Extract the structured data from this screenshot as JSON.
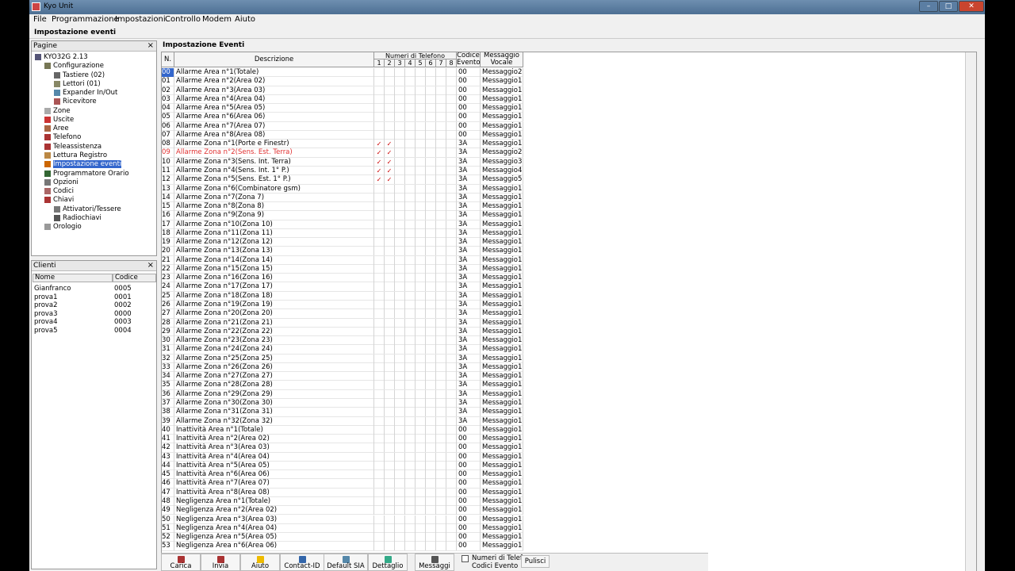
{
  "window": {
    "title": "Kyo Unit",
    "min": "–",
    "max": "□",
    "close": "✕"
  },
  "menu": [
    "File",
    "Programmazione",
    "Impostazioni",
    "Controllo",
    "Modem",
    "Aiuto"
  ],
  "header": "Impostazione eventi",
  "pagine": {
    "title": "Pagine",
    "close": "×",
    "items": [
      {
        "label": "KYO32G 2.13",
        "level": 0,
        "icon": "computer-icon"
      },
      {
        "label": "Configurazione",
        "level": 1,
        "icon": "wrench-icon"
      },
      {
        "label": "Tastiere (02)",
        "level": 2,
        "icon": "keypad-icon"
      },
      {
        "label": "Lettori (01)",
        "level": 2,
        "icon": "reader-icon"
      },
      {
        "label": "Expander In/Out",
        "level": 2,
        "icon": "expander-icon"
      },
      {
        "label": "Ricevitore",
        "level": 2,
        "icon": "antenna-icon"
      },
      {
        "label": "Zone",
        "level": 1,
        "icon": "zone-icon"
      },
      {
        "label": "Uscite",
        "level": 1,
        "icon": "output-icon"
      },
      {
        "label": "Aree",
        "level": 1,
        "icon": "area-icon"
      },
      {
        "label": "Telefono",
        "level": 1,
        "icon": "phone-icon"
      },
      {
        "label": "Teleassistenza",
        "level": 1,
        "icon": "remote-icon"
      },
      {
        "label": "Lettura Registro",
        "level": 1,
        "icon": "log-icon"
      },
      {
        "label": "Impostazione eventi",
        "level": 1,
        "icon": "event-icon",
        "selected": true
      },
      {
        "label": "Programmatore Orario",
        "level": 1,
        "icon": "scheduler-icon"
      },
      {
        "label": "Opzioni",
        "level": 1,
        "icon": "options-icon"
      },
      {
        "label": "Codici",
        "level": 1,
        "icon": "codes-icon"
      },
      {
        "label": "Chiavi",
        "level": 1,
        "icon": "key-icon"
      },
      {
        "label": "Attivatori/Tessere",
        "level": 2,
        "icon": "activator-icon"
      },
      {
        "label": "Radiochiavi",
        "level": 2,
        "icon": "radiokey-icon"
      },
      {
        "label": "Orologio",
        "level": 1,
        "icon": "clock-icon"
      }
    ]
  },
  "clienti": {
    "title": "Clienti",
    "close": "×",
    "col_nome": "Nome",
    "col_codice": "Codice",
    "rows": [
      [
        "Gianfranco",
        "0005"
      ],
      [
        "prova1",
        "0001"
      ],
      [
        "prova2",
        "0002"
      ],
      [
        "prova3",
        "0000"
      ],
      [
        "prova4",
        "0003"
      ],
      [
        "prova5",
        "0004"
      ]
    ]
  },
  "main": {
    "title": "Impostazione Eventi",
    "headers": {
      "n": "N.",
      "descrizione": "Descrizione",
      "numeri": "Numeri di Telefono",
      "phones": [
        "1",
        "2",
        "3",
        "4",
        "5",
        "6",
        "7",
        "8"
      ],
      "codice": "Codice Evento",
      "messaggio": "Messaggio Vocale"
    },
    "rows": [
      [
        "00",
        "Allarme Area n°1(Totale)",
        "",
        "",
        "00",
        "Messaggio2"
      ],
      [
        "01",
        "Allarme Area n°2(Area 02)",
        "",
        "",
        "00",
        "Messaggio1"
      ],
      [
        "02",
        "Allarme Area n°3(Area 03)",
        "",
        "",
        "00",
        "Messaggio1"
      ],
      [
        "03",
        "Allarme Area n°4(Area 04)",
        "",
        "",
        "00",
        "Messaggio1"
      ],
      [
        "04",
        "Allarme Area n°5(Area 05)",
        "",
        "",
        "00",
        "Messaggio1"
      ],
      [
        "05",
        "Allarme Area n°6(Area 06)",
        "",
        "",
        "00",
        "Messaggio1"
      ],
      [
        "06",
        "Allarme Area n°7(Area 07)",
        "",
        "",
        "00",
        "Messaggio1"
      ],
      [
        "07",
        "Allarme Area n°8(Area 08)",
        "",
        "",
        "00",
        "Messaggio1"
      ],
      [
        "08",
        "Allarme Zona n°1(Porte e  Finestr)",
        "✓",
        "✓",
        "3A",
        "Messaggio1"
      ],
      [
        "09",
        "Allarme Zona n°2(Sens. Est. Terra)",
        "✓",
        "✓",
        "3A",
        "Messaggio2"
      ],
      [
        "10",
        "Allarme Zona n°3(Sens. Int. Terra)",
        "✓",
        "✓",
        "3A",
        "Messaggio3"
      ],
      [
        "11",
        "Allarme Zona n°4(Sens. Int. 1° P.)",
        "✓",
        "✓",
        "3A",
        "Messaggio4"
      ],
      [
        "12",
        "Allarme Zona n°5(Sens. Est. 1° P.)",
        "✓",
        "✓",
        "3A",
        "Messaggio5"
      ],
      [
        "13",
        "Allarme Zona n°6(Combinatore gsm)",
        "",
        "",
        "3A",
        "Messaggio1"
      ],
      [
        "14",
        "Allarme Zona n°7(Zona 7)",
        "",
        "",
        "3A",
        "Messaggio1"
      ],
      [
        "15",
        "Allarme Zona n°8(Zona 8)",
        "",
        "",
        "3A",
        "Messaggio1"
      ],
      [
        "16",
        "Allarme Zona n°9(Zona 9)",
        "",
        "",
        "3A",
        "Messaggio1"
      ],
      [
        "17",
        "Allarme Zona n°10(Zona 10)",
        "",
        "",
        "3A",
        "Messaggio1"
      ],
      [
        "18",
        "Allarme Zona n°11(Zona 11)",
        "",
        "",
        "3A",
        "Messaggio1"
      ],
      [
        "19",
        "Allarme Zona n°12(Zona 12)",
        "",
        "",
        "3A",
        "Messaggio1"
      ],
      [
        "20",
        "Allarme Zona n°13(Zona 13)",
        "",
        "",
        "3A",
        "Messaggio1"
      ],
      [
        "21",
        "Allarme Zona n°14(Zona 14)",
        "",
        "",
        "3A",
        "Messaggio1"
      ],
      [
        "22",
        "Allarme Zona n°15(Zona 15)",
        "",
        "",
        "3A",
        "Messaggio1"
      ],
      [
        "23",
        "Allarme Zona n°16(Zona 16)",
        "",
        "",
        "3A",
        "Messaggio1"
      ],
      [
        "24",
        "Allarme Zona n°17(Zona 17)",
        "",
        "",
        "3A",
        "Messaggio1"
      ],
      [
        "25",
        "Allarme Zona n°18(Zona 18)",
        "",
        "",
        "3A",
        "Messaggio1"
      ],
      [
        "26",
        "Allarme Zona n°19(Zona 19)",
        "",
        "",
        "3A",
        "Messaggio1"
      ],
      [
        "27",
        "Allarme Zona n°20(Zona 20)",
        "",
        "",
        "3A",
        "Messaggio1"
      ],
      [
        "28",
        "Allarme Zona n°21(Zona 21)",
        "",
        "",
        "3A",
        "Messaggio1"
      ],
      [
        "29",
        "Allarme Zona n°22(Zona 22)",
        "",
        "",
        "3A",
        "Messaggio1"
      ],
      [
        "30",
        "Allarme Zona n°23(Zona 23)",
        "",
        "",
        "3A",
        "Messaggio1"
      ],
      [
        "31",
        "Allarme Zona n°24(Zona 24)",
        "",
        "",
        "3A",
        "Messaggio1"
      ],
      [
        "32",
        "Allarme Zona n°25(Zona 25)",
        "",
        "",
        "3A",
        "Messaggio1"
      ],
      [
        "33",
        "Allarme Zona n°26(Zona 26)",
        "",
        "",
        "3A",
        "Messaggio1"
      ],
      [
        "34",
        "Allarme Zona n°27(Zona 27)",
        "",
        "",
        "3A",
        "Messaggio1"
      ],
      [
        "35",
        "Allarme Zona n°28(Zona 28)",
        "",
        "",
        "3A",
        "Messaggio1"
      ],
      [
        "36",
        "Allarme Zona n°29(Zona 29)",
        "",
        "",
        "3A",
        "Messaggio1"
      ],
      [
        "37",
        "Allarme Zona n°30(Zona 30)",
        "",
        "",
        "3A",
        "Messaggio1"
      ],
      [
        "38",
        "Allarme Zona n°31(Zona 31)",
        "",
        "",
        "3A",
        "Messaggio1"
      ],
      [
        "39",
        "Allarme Zona n°32(Zona 32)",
        "",
        "",
        "3A",
        "Messaggio1"
      ],
      [
        "40",
        "Inattività Area n°1(Totale)",
        "",
        "",
        "00",
        "Messaggio1"
      ],
      [
        "41",
        "Inattività Area n°2(Area 02)",
        "",
        "",
        "00",
        "Messaggio1"
      ],
      [
        "42",
        "Inattività Area n°3(Area 03)",
        "",
        "",
        "00",
        "Messaggio1"
      ],
      [
        "43",
        "Inattività Area n°4(Area 04)",
        "",
        "",
        "00",
        "Messaggio1"
      ],
      [
        "44",
        "Inattività Area n°5(Area 05)",
        "",
        "",
        "00",
        "Messaggio1"
      ],
      [
        "45",
        "Inattività Area n°6(Area 06)",
        "",
        "",
        "00",
        "Messaggio1"
      ],
      [
        "46",
        "Inattività Area n°7(Area 07)",
        "",
        "",
        "00",
        "Messaggio1"
      ],
      [
        "47",
        "Inattività Area n°8(Area 08)",
        "",
        "",
        "00",
        "Messaggio1"
      ],
      [
        "48",
        "Negligenza Area n°1(Totale)",
        "",
        "",
        "00",
        "Messaggio1"
      ],
      [
        "49",
        "Negligenza Area n°2(Area 02)",
        "",
        "",
        "00",
        "Messaggio1"
      ],
      [
        "50",
        "Negligenza Area n°3(Area 03)",
        "",
        "",
        "00",
        "Messaggio1"
      ],
      [
        "51",
        "Negligenza Area n°4(Area 04)",
        "",
        "",
        "00",
        "Messaggio1"
      ],
      [
        "52",
        "Negligenza Area n°5(Area 05)",
        "",
        "",
        "00",
        "Messaggio1"
      ],
      [
        "53",
        "Negligenza Area n°6(Area 06)",
        "",
        "",
        "00",
        "Messaggio1"
      ]
    ],
    "highlight_row": "09",
    "selected_cell": "00"
  },
  "toolbar": {
    "buttons": [
      {
        "label": "Carica",
        "icon": "load-icon"
      },
      {
        "label": "Invia",
        "icon": "send-icon"
      },
      {
        "label": "Aiuto",
        "icon": "help-icon"
      },
      {
        "label": "Contact-ID",
        "icon": "contactid-icon"
      },
      {
        "label": "Default SIA",
        "icon": "sia-icon"
      },
      {
        "label": "Dettaglio",
        "icon": "detail-icon"
      },
      {
        "label": "Messaggi",
        "icon": "messages-icon"
      }
    ],
    "opt1": "Numeri di Telefo",
    "opt2": "Codici Evento",
    "pulisci": "Pulisci"
  },
  "colors": {
    "highlight": "#e03030",
    "check": "#cc0000",
    "selected": "#3366cc"
  }
}
